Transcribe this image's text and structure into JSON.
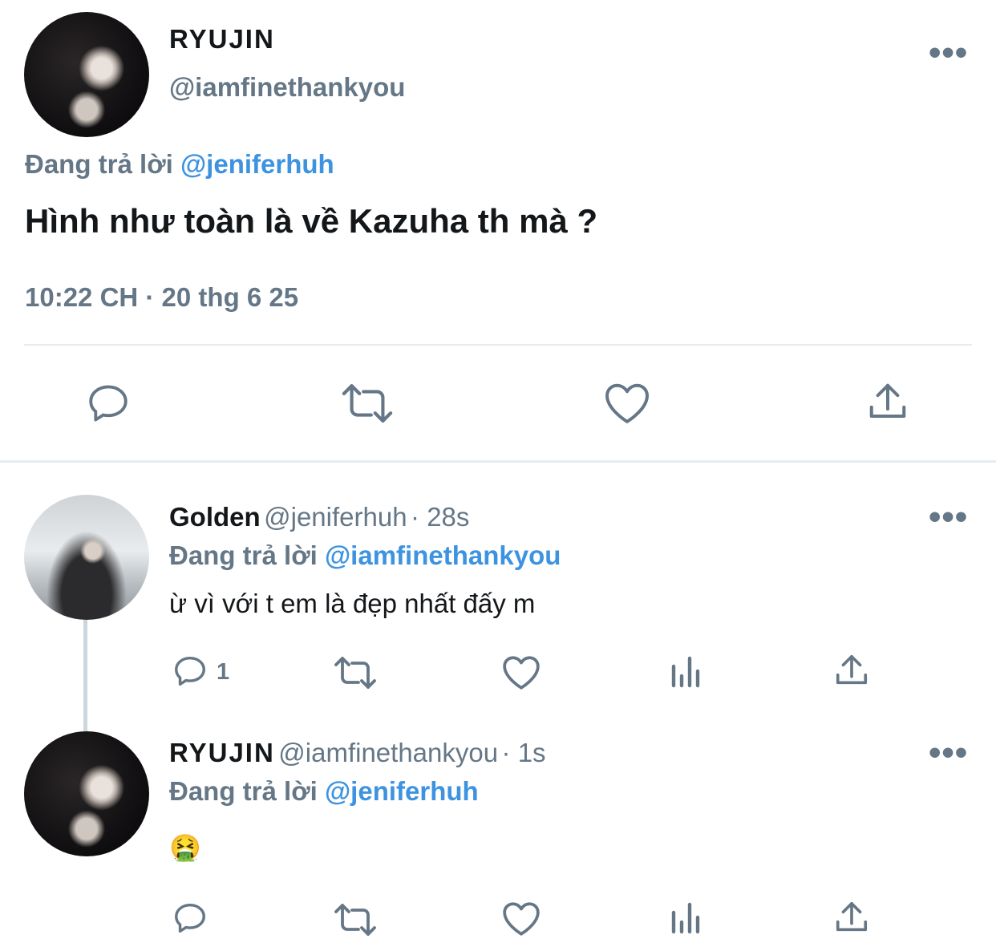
{
  "main_tweet": {
    "author_name": "RYUJIN",
    "author_handle": "@iamfinethankyou",
    "replying_prefix": "Đang trả lời",
    "replying_to": "@jeniferhuh",
    "text": "Hình như toàn là về Kazuha th mà ?",
    "timestamp": "10:22 CH · 20 thg 6 25",
    "more_label": "•••",
    "actions": [
      "reply-icon",
      "retweet-icon",
      "like-icon",
      "share-icon"
    ]
  },
  "replies": [
    {
      "author_name": "Golden",
      "author_handle": "@jeniferhuh",
      "time": "· 28s",
      "replying_prefix": "Đang trả lời",
      "replying_to": "@iamfinethankyou",
      "text": "ừ vì với t em là đẹp nhất đấy m",
      "reply_count": "1",
      "more_label": "•••",
      "actions": [
        "reply-icon",
        "retweet-icon",
        "like-icon",
        "analytics-icon",
        "share-icon"
      ]
    },
    {
      "author_name": "RYUJIN",
      "author_handle": "@iamfinethankyou",
      "time": "· 1s",
      "replying_prefix": "Đang trả lời",
      "replying_to": "@jeniferhuh",
      "text": "🤮",
      "more_label": "•••",
      "actions": [
        "reply-icon",
        "retweet-icon",
        "like-icon",
        "analytics-icon",
        "share-icon"
      ]
    }
  ],
  "colors": {
    "text": "#14171a",
    "secondary": "#657786",
    "link": "#3d93e0",
    "divider": "#e6ecf0"
  }
}
